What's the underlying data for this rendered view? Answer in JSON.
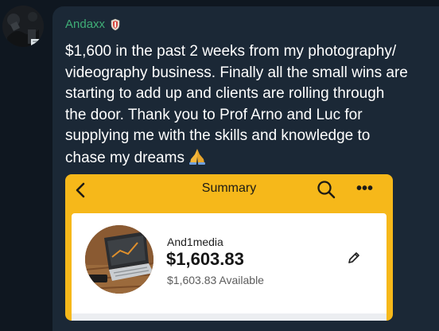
{
  "message": {
    "author": "Andaxx",
    "lines": [
      "$1,600 in the past 2 weeks from my photography/",
      "videography business. Finally all the small wins are",
      "starting to add up and clients are rolling through",
      "the door. Thank you to Prof Arno and Luc for",
      "supplying me with the skills and knowledge to",
      "chase my dreams"
    ],
    "emoji": "folded-hands"
  },
  "screenshot": {
    "title": "Summary",
    "account_name": "And1media",
    "balance": "$1,603.83",
    "available": "$1,603.83 Available"
  },
  "colors": {
    "background": "#0f1720",
    "bubble": "#1b2836",
    "author": "#3fae77",
    "app_bar": "#f6b81a"
  },
  "icons": [
    "back-chevron-icon",
    "search-icon",
    "more-options-icon",
    "edit-pencil-icon",
    "shield-badge-icon"
  ]
}
